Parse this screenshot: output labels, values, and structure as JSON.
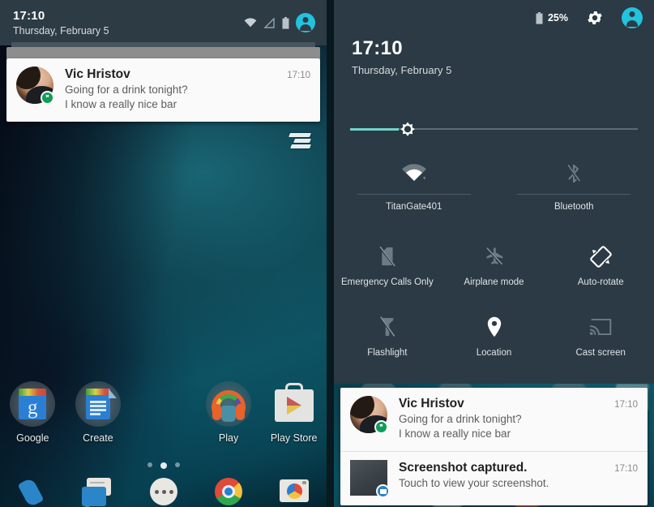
{
  "left": {
    "status_bar": {
      "time": "17:10",
      "date": "Thursday, February 5",
      "icons": [
        "wifi-icon",
        "signal-icon",
        "battery-icon",
        "user-avatar-icon"
      ]
    },
    "notification": {
      "title": "Vic Hristov",
      "time": "17:10",
      "line1": "Going for a drink tonight?",
      "line2": "I know a really nice bar",
      "badge": "hangouts-badge"
    },
    "clear_all_label": "clear-all-notifications",
    "apps": [
      {
        "label": "Google",
        "icon": "google-search-icon"
      },
      {
        "label": "Create",
        "icon": "google-docs-create-icon"
      },
      {
        "label": "Play",
        "icon": "google-play-music-icon"
      },
      {
        "label": "Play Store",
        "icon": "google-play-store-icon"
      }
    ],
    "page_dots": {
      "count": 3,
      "active_index": 1
    },
    "dock": [
      "phone-icon",
      "messenger-icon",
      "app-drawer-icon",
      "chrome-icon",
      "camera-icon"
    ]
  },
  "right": {
    "status_bar": {
      "battery_percent": "25%",
      "gear": "settings-gear-icon",
      "avatar": "user-avatar-icon"
    },
    "clock": {
      "time": "17:10",
      "date": "Thursday, February 5"
    },
    "brightness": {
      "value_percent": 18,
      "handle_icon": "brightness-sun-icon"
    },
    "tiles_row1": [
      {
        "label": "TitanGate401",
        "icon": "wifi-icon",
        "enabled": true
      },
      {
        "label": "Bluetooth",
        "icon": "bluetooth-off-icon",
        "enabled": false
      }
    ],
    "tiles_row2": [
      {
        "label": "Emergency Calls Only",
        "icon": "no-sim-icon",
        "enabled": false
      },
      {
        "label": "Airplane mode",
        "icon": "airplane-off-icon",
        "enabled": false
      },
      {
        "label": "Auto-rotate",
        "icon": "auto-rotate-icon",
        "enabled": true
      }
    ],
    "tiles_row3": [
      {
        "label": "Flashlight",
        "icon": "flashlight-icon",
        "enabled": false
      },
      {
        "label": "Location",
        "icon": "location-pin-icon",
        "enabled": true
      },
      {
        "label": "Cast screen",
        "icon": "cast-screen-icon",
        "enabled": false
      }
    ],
    "notifications": [
      {
        "title": "Vic Hristov",
        "time": "17:10",
        "line1": "Going for a drink tonight?",
        "line2": "I know a really nice bar",
        "badge": "hangouts-badge"
      },
      {
        "title": "Screenshot captured.",
        "time": "17:10",
        "line1": "Touch to view your screenshot.",
        "line2": "",
        "badge": "screenshot-badge"
      }
    ]
  },
  "colors": {
    "shade_bg": "#2b3a44",
    "statusbar_bg": "#2d3b45",
    "accent_cyan": "#21c3dd",
    "slider_teal": "#6fd4c9",
    "notif_bg": "#fafafa",
    "hangouts_green": "#0f9d58",
    "screenshot_blue": "#2b7fc1"
  }
}
